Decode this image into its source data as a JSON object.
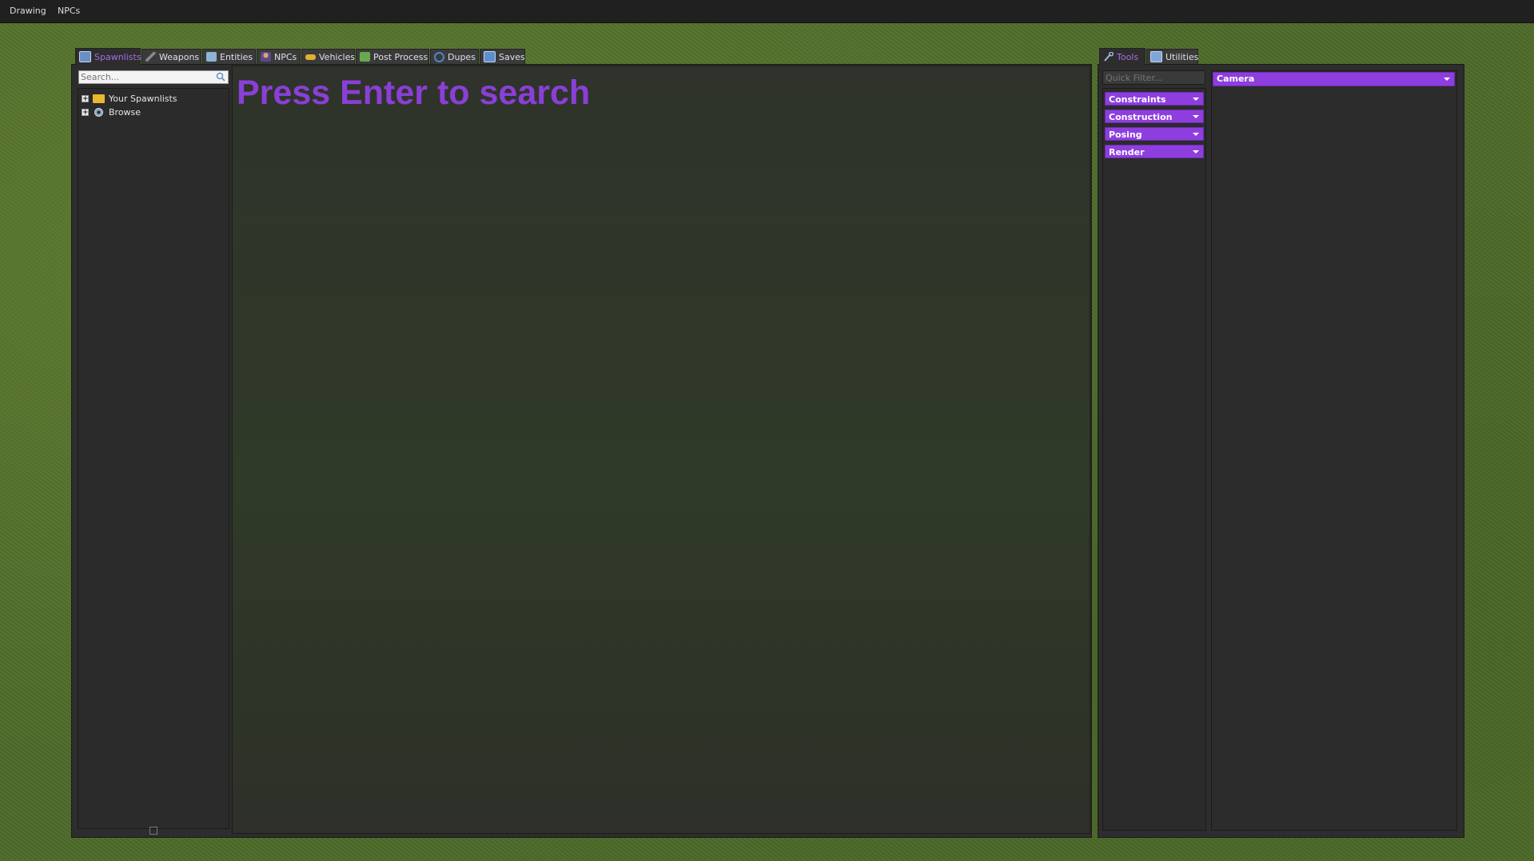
{
  "menubar": {
    "items": [
      "Drawing",
      "NPCs"
    ]
  },
  "spawnmenu": {
    "tabs": [
      {
        "label": "Spawnlists",
        "icon": "spawnlist-icon",
        "active": true
      },
      {
        "label": "Weapons",
        "icon": "weapon-icon",
        "active": false
      },
      {
        "label": "Entities",
        "icon": "entity-icon",
        "active": false
      },
      {
        "label": "NPCs",
        "icon": "npc-icon",
        "active": false
      },
      {
        "label": "Vehicles",
        "icon": "vehicle-icon",
        "active": false
      },
      {
        "label": "Post Process",
        "icon": "postprocess-icon",
        "active": false
      },
      {
        "label": "Dupes",
        "icon": "dupes-icon",
        "active": false
      },
      {
        "label": "Saves",
        "icon": "saves-icon",
        "active": false
      }
    ],
    "search": {
      "placeholder": "Search...",
      "value": ""
    },
    "tree": [
      {
        "label": "Your Spawnlists",
        "icon": "folder-icon",
        "expander": "+"
      },
      {
        "label": "Browse",
        "icon": "gear-icon",
        "expander": "+"
      }
    ],
    "message": "Press Enter to search"
  },
  "toolmenu": {
    "tabs": [
      {
        "label": "Tools",
        "icon": "wrench-icon",
        "active": true
      },
      {
        "label": "Utilities",
        "icon": "utilities-icon",
        "active": false
      }
    ],
    "filter": {
      "placeholder": "Quick Filter...",
      "value": ""
    },
    "categories": [
      "Constraints",
      "Construction",
      "Posing",
      "Render"
    ],
    "selected_tool": "Camera"
  },
  "colors": {
    "accent": "#8e3ede",
    "active_tab_text": "#a56de2",
    "panel": "#2d2d2d"
  }
}
